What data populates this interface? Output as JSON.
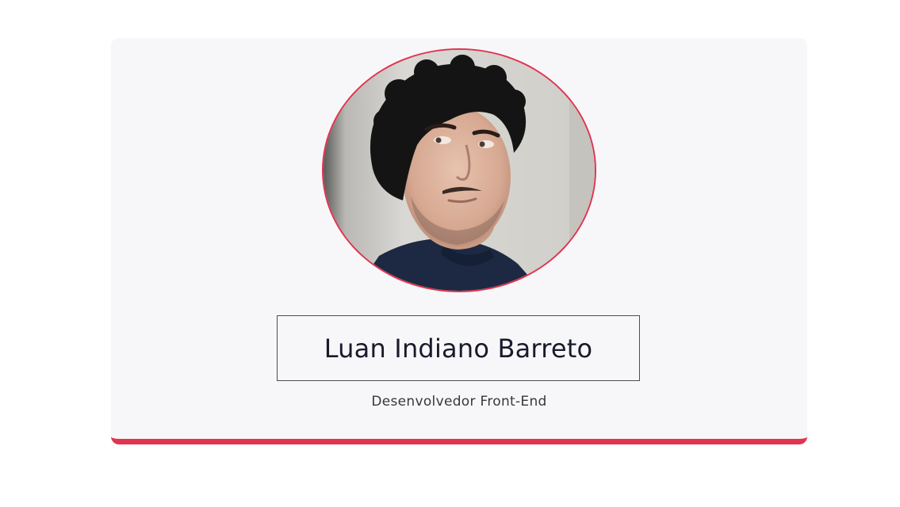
{
  "profile": {
    "name": "Luan Indiano Barreto",
    "role": "Desenvolvedor Front-End",
    "avatar_icon": "profile-photo"
  },
  "colors": {
    "accent": "#e2334f",
    "card_background": "#f7f7f9",
    "name_text": "#191a2c",
    "role_text": "#37373d"
  }
}
